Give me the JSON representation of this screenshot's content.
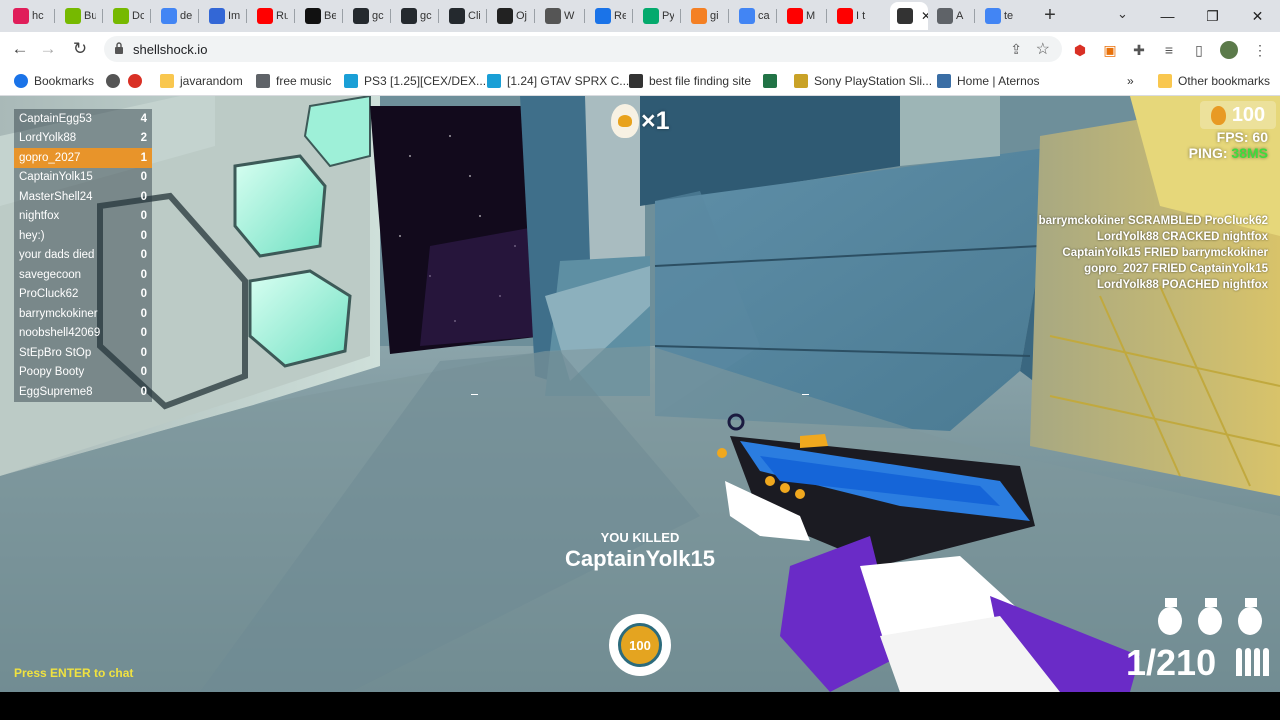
{
  "browser": {
    "tabs": [
      {
        "title": "hc",
        "icon": "slack-icon",
        "color": "#e01e5a"
      },
      {
        "title": "Bu",
        "icon": "nvidia-icon",
        "color": "#76b900"
      },
      {
        "title": "Dc",
        "icon": "nvidia-icon",
        "color": "#76b900"
      },
      {
        "title": "de",
        "icon": "google-icon",
        "color": "#4285f4"
      },
      {
        "title": "Im",
        "icon": "chart-icon",
        "color": "#3367d6"
      },
      {
        "title": "Ru",
        "icon": "youtube-icon",
        "color": "#ff0000"
      },
      {
        "title": "Be",
        "icon": "medium-icon",
        "color": "#111111"
      },
      {
        "title": "gc",
        "icon": "github-icon",
        "color": "#24292e"
      },
      {
        "title": "gc",
        "icon": "github-icon",
        "color": "#24292e"
      },
      {
        "title": "Cli",
        "icon": "github-icon",
        "color": "#24292e"
      },
      {
        "title": "Oj",
        "icon": "openai-icon",
        "color": "#222222"
      },
      {
        "title": "W",
        "icon": "globe-icon",
        "color": "#555555"
      },
      {
        "title": "Re",
        "icon": "dot-icon",
        "color": "#1a73e8"
      },
      {
        "title": "Py",
        "icon": "w3-icon",
        "color": "#04aa6d"
      },
      {
        "title": "gi",
        "icon": "stack-icon",
        "color": "#f48024"
      },
      {
        "title": "ca",
        "icon": "google-icon",
        "color": "#4285f4"
      },
      {
        "title": "M",
        "icon": "youtube-icon",
        "color": "#ff0000"
      },
      {
        "title": "I t",
        "icon": "youtube-icon",
        "color": "#ff0000"
      },
      {
        "title": "",
        "icon": "speaker-icon",
        "color": "#333333",
        "active": true
      },
      {
        "title": "A",
        "icon": "image-icon",
        "color": "#5f6368"
      },
      {
        "title": "te",
        "icon": "google-icon",
        "color": "#4285f4"
      }
    ],
    "url": "shellshock.io",
    "bookmarks": [
      {
        "label": "Bookmarks",
        "icon": "star-icon",
        "color": "#1a73e8"
      },
      {
        "label": "",
        "icon": "globe-icon",
        "color": "#555555"
      },
      {
        "label": "",
        "icon": "heart-icon",
        "color": "#d93025"
      },
      {
        "label": "javarandom",
        "icon": "folder-icon",
        "color": "#f9c74f"
      },
      {
        "label": "free music",
        "icon": "alien-icon",
        "color": "#5f6368"
      },
      {
        "label": "PS3 [1.25][CEX/DEX...",
        "icon": "c-logo-icon",
        "color": "#1a9fd6"
      },
      {
        "label": "[1.24] GTAV SPRX C...",
        "icon": "c-logo-icon",
        "color": "#1a9fd6"
      },
      {
        "label": "best file finding site",
        "icon": "camera-icon",
        "color": "#333333"
      },
      {
        "label": "",
        "icon": "excel-icon",
        "color": "#217346"
      },
      {
        "label": "Sony PlayStation Sli...",
        "icon": "bag-icon",
        "color": "#c9a227"
      },
      {
        "label": "Home | Aternos",
        "icon": "grid-icon",
        "color": "#3a6ea5"
      }
    ],
    "other_bookmarks": "Other bookmarks"
  },
  "game": {
    "leaderboard": [
      {
        "name": "CaptainEgg53",
        "score": "4"
      },
      {
        "name": "LordYolk88",
        "score": "2"
      },
      {
        "name": "gopro_2027",
        "score": "1",
        "me": true
      },
      {
        "name": "CaptainYolk15",
        "score": "0"
      },
      {
        "name": "MasterShell24",
        "score": "0"
      },
      {
        "name": "nightfox",
        "score": "0"
      },
      {
        "name": "hey:)",
        "score": "0"
      },
      {
        "name": "your dads died",
        "score": "0"
      },
      {
        "name": "savegecoon",
        "score": "0"
      },
      {
        "name": "ProCluck62",
        "score": "0"
      },
      {
        "name": "barrymckokiner",
        "score": "0"
      },
      {
        "name": "noobshell42069",
        "score": "0"
      },
      {
        "name": "StEpBro StOp",
        "score": "0"
      },
      {
        "name": "Poopy Booty",
        "score": "0"
      },
      {
        "name": "EggSupreme8",
        "score": "0"
      }
    ],
    "kill_streak": "×1",
    "eggs": "100",
    "fps_label": "FPS: 60",
    "ping_label": "PING:",
    "ping_value": "38MS",
    "killfeed": [
      "barrymckokiner SCRAMBLED ProCluck62",
      "LordYolk88 CRACKED nightfox",
      "CaptainYolk15 FRIED barrymckokiner",
      "gopro_2027 FRIED CaptainYolk15",
      "LordYolk88 POACHED nightfox"
    ],
    "you_killed_label": "YOU KILLED",
    "killed_player": "CaptainYolk15",
    "health": "100",
    "ammo": "1/210",
    "grenades": 3,
    "chat_hint": "Press ENTER to chat"
  }
}
